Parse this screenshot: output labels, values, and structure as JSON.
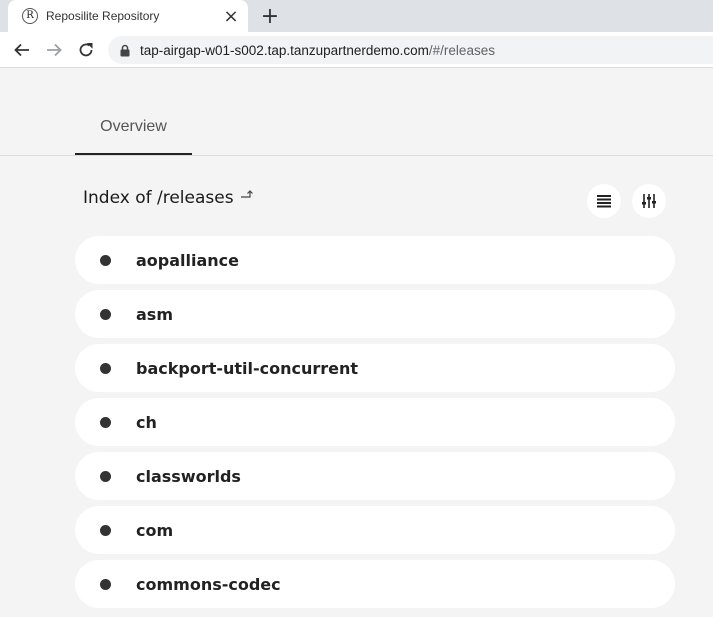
{
  "browser": {
    "tab": {
      "favicon_letter": "R",
      "title": "Reposilite Repository",
      "close_glyph": "×"
    },
    "new_tab_glyph": "+",
    "address": {
      "host": "tap-airgap-w01-s002.tap.tanzupartnerdemo.com",
      "path": "/#/releases"
    }
  },
  "app": {
    "tabs": [
      {
        "label": "Overview",
        "active": true
      }
    ],
    "index_title": "Index of /releases",
    "items": [
      {
        "name": "aopalliance"
      },
      {
        "name": "asm"
      },
      {
        "name": "backport-util-concurrent"
      },
      {
        "name": "ch"
      },
      {
        "name": "classworlds"
      },
      {
        "name": "com"
      },
      {
        "name": "commons-codec"
      }
    ]
  },
  "colors": {
    "page_background": "#f4f4f4",
    "card_background": "#ffffff",
    "text": "#222222"
  }
}
